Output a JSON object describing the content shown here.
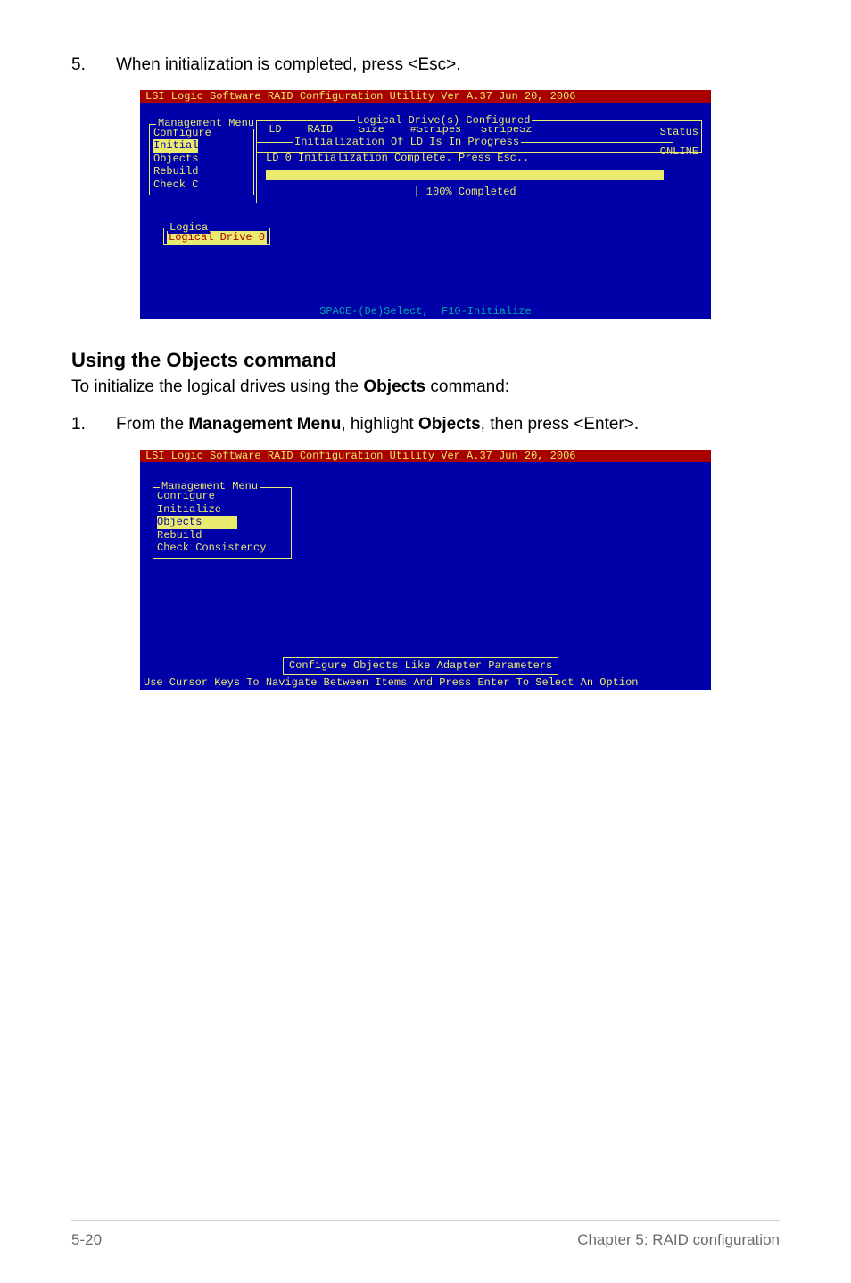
{
  "step5": {
    "n": "5.",
    "text_a": "When initialization is completed, press <Esc>."
  },
  "bios1": {
    "title": "LSI Logic Software RAID Configuration Utility Ver A.37 Jun 20, 2006",
    "menu_label": "Management Menu",
    "menu": {
      "configure": "Configure",
      "initial": "Initial",
      "objects": "Objects",
      "rebuild": "Rebuild",
      "check": "Check C"
    },
    "ld_label": "Logical Drive(s) Configured",
    "ld_hdr": " LD    RAID    Size    #Stripes   StripeSz",
    "status_h": "Status",
    "status_v": "ONLINE",
    "init_label": "Initialization Of LD Is In Progress",
    "init_msg": "LD 0 Initialization Complete. Press Esc..",
    "progress": "| 100% Completed",
    "logica_label": "Logica",
    "logica_item": "Logical Drive 0",
    "footer": "SPACE-(De)Select,  F10-Initialize"
  },
  "section": {
    "h": "Using the Objects command",
    "p_a": "To initialize the logical drives using the ",
    "p_b": "Objects",
    "p_c": " command:"
  },
  "step1": {
    "n": "1.",
    "a": "From the ",
    "b": "Management Menu",
    "c": ", highlight ",
    "d": "Objects",
    "e": ", then press <Enter>."
  },
  "bios2": {
    "title": "LSI Logic Software RAID Configuration Utility Ver A.37 Jun 20, 2006",
    "menu_label": "Management Menu",
    "menu": {
      "configure": "Configure",
      "initialize": "Initialize",
      "objects": "Objects",
      "rebuild": "Rebuild",
      "check": "Check Consistency"
    },
    "help": "Configure Objects Like Adapter Parameters",
    "footer": "Use Cursor Keys To Navigate Between Items And Press Enter To Select An Option"
  },
  "pn": "5-20",
  "ch": "Chapter 5: RAID configuration"
}
